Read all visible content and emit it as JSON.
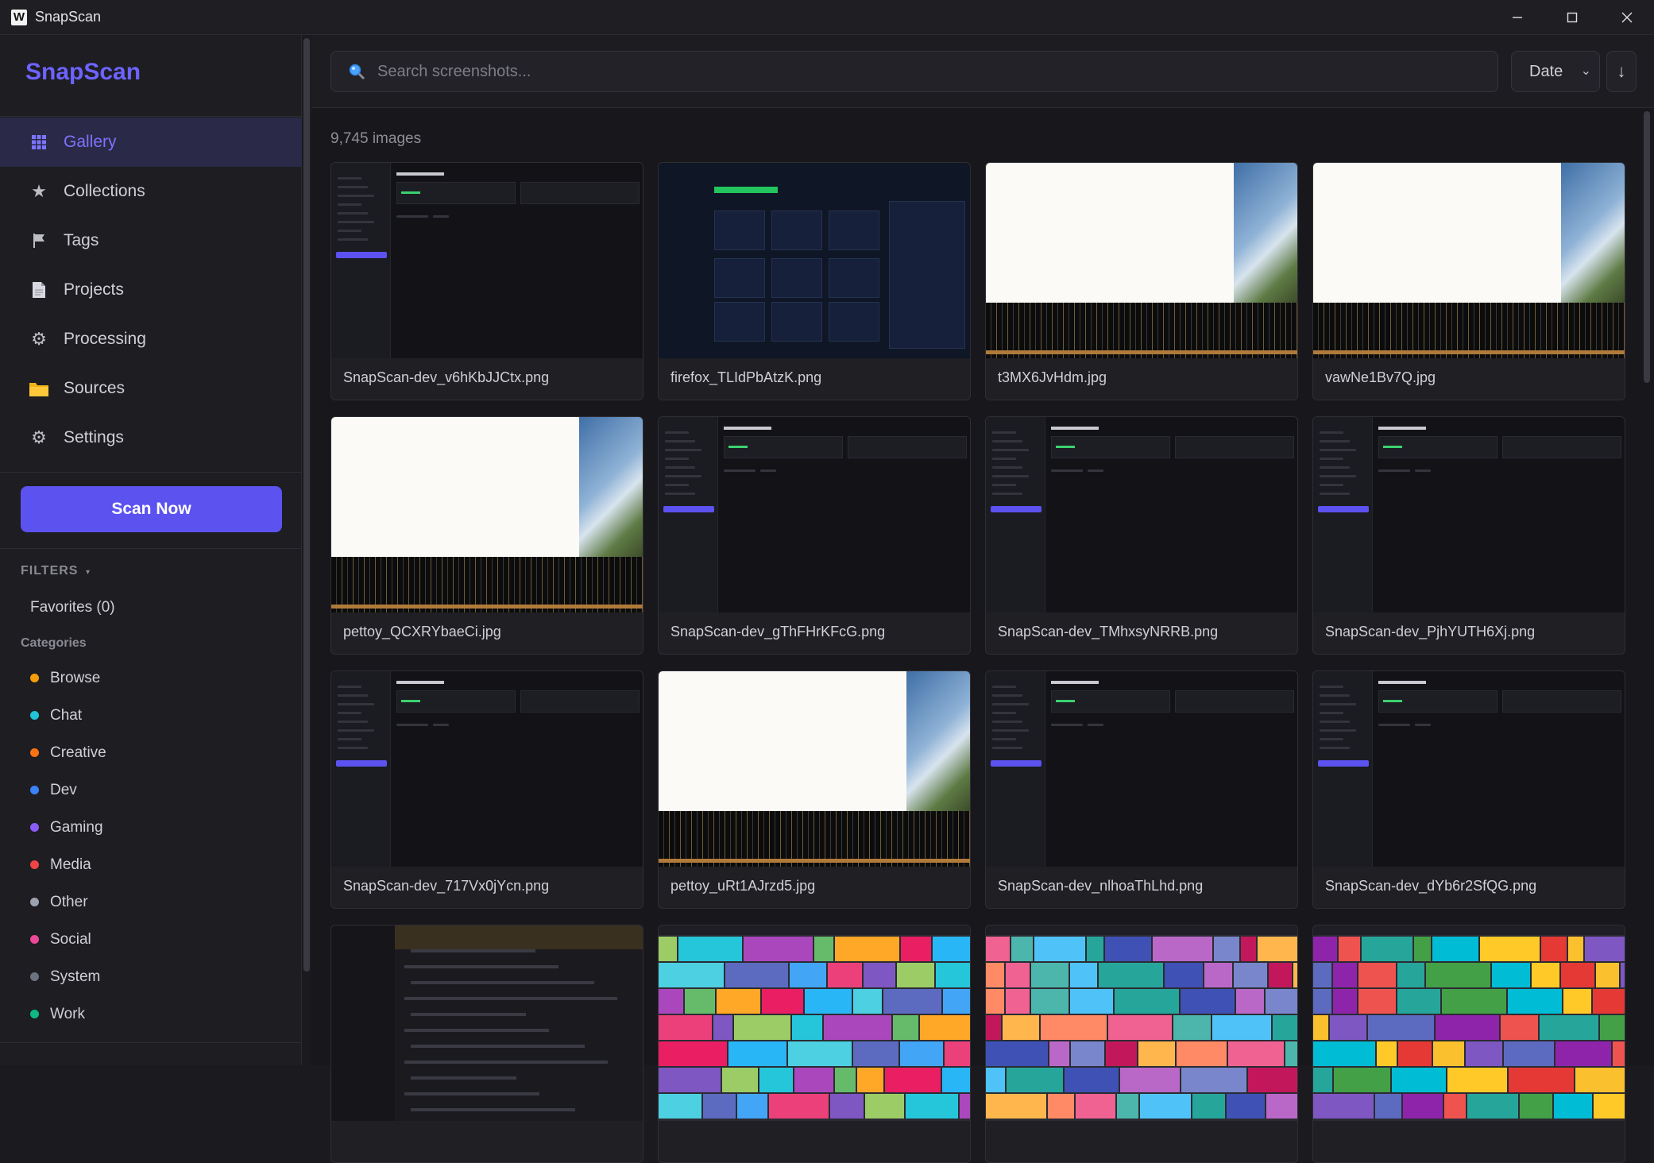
{
  "window": {
    "title": "SnapScan",
    "icon_letter": "W"
  },
  "sidebar": {
    "brand": "SnapScan",
    "nav": [
      {
        "label": "Gallery",
        "icon": "grid-icon",
        "active": true
      },
      {
        "label": "Collections",
        "icon": "star-icon"
      },
      {
        "label": "Tags",
        "icon": "flag-icon"
      },
      {
        "label": "Projects",
        "icon": "document-icon"
      },
      {
        "label": "Processing",
        "icon": "gear-icon"
      },
      {
        "label": "Sources",
        "icon": "folder-icon"
      },
      {
        "label": "Settings",
        "icon": "gear-icon"
      }
    ],
    "scan_button": "Scan Now",
    "filters_label": "FILTERS",
    "favorites": "Favorites (0)",
    "categories_label": "Categories",
    "categories": [
      {
        "label": "Browse",
        "color": "#f59e0b"
      },
      {
        "label": "Chat",
        "color": "#22c3d6"
      },
      {
        "label": "Creative",
        "color": "#f97316"
      },
      {
        "label": "Dev",
        "color": "#3b82f6"
      },
      {
        "label": "Gaming",
        "color": "#8b5cf6"
      },
      {
        "label": "Media",
        "color": "#ef4444"
      },
      {
        "label": "Other",
        "color": "#9ca3af"
      },
      {
        "label": "Social",
        "color": "#ec4899"
      },
      {
        "label": "System",
        "color": "#6b7280"
      },
      {
        "label": "Work",
        "color": "#10b981"
      }
    ]
  },
  "toolbar": {
    "search_placeholder": "Search screenshots...",
    "sort_value": "Date",
    "sort_direction": "↓"
  },
  "gallery": {
    "count": "9,745 images",
    "items": [
      {
        "name": "SnapScan-dev_v6hKbJJCtx.png",
        "thumb": "app"
      },
      {
        "name": "firefox_TLIdPbAtzK.png",
        "thumb": "dark"
      },
      {
        "name": "t3MX6JvHdm.jpg",
        "thumb": "photo"
      },
      {
        "name": "vawNe1Bv7Q.jpg",
        "thumb": "photo"
      },
      {
        "name": "pettoy_QCXRYbaeCi.jpg",
        "thumb": "photo"
      },
      {
        "name": "SnapScan-dev_gThFHrKFcG.png",
        "thumb": "app"
      },
      {
        "name": "SnapScan-dev_TMhxsyNRRB.png",
        "thumb": "app"
      },
      {
        "name": "SnapScan-dev_PjhYUTH6Xj.png",
        "thumb": "app"
      },
      {
        "name": "SnapScan-dev_717Vx0jYcn.png",
        "thumb": "app"
      },
      {
        "name": "pettoy_uRt1AJrzd5.jpg",
        "thumb": "photo"
      },
      {
        "name": "SnapScan-dev_nlhoaThLhd.png",
        "thumb": "app"
      },
      {
        "name": "SnapScan-dev_dYb6r2SfQG.png",
        "thumb": "app"
      },
      {
        "name": "",
        "thumb": "chat"
      },
      {
        "name": "",
        "thumb": "tree"
      },
      {
        "name": "",
        "thumb": "tree2"
      },
      {
        "name": "",
        "thumb": "tree3"
      }
    ]
  }
}
